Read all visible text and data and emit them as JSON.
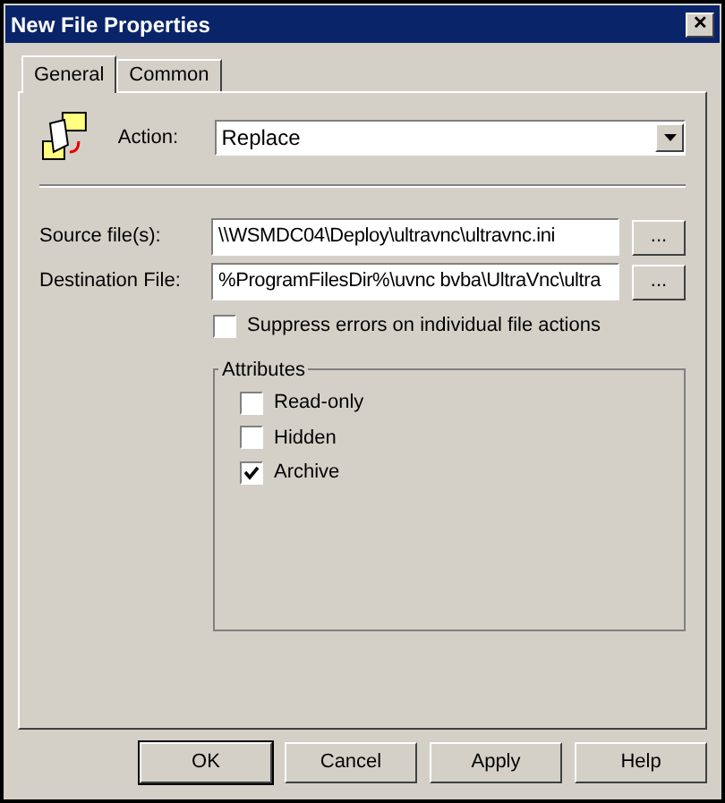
{
  "window": {
    "title": "New File Properties",
    "close": "✕"
  },
  "tabs": [
    {
      "label": "General",
      "selected": true
    },
    {
      "label": "Common",
      "selected": false
    }
  ],
  "action": {
    "label": "Action:",
    "value": "Replace"
  },
  "fields": [
    {
      "label": "Source file(s):",
      "value": "\\\\WSMDC04\\Deploy\\ultravnc\\ultravnc.ini",
      "browse": "..."
    },
    {
      "label": "Destination File:",
      "value": "%ProgramFilesDir%\\uvnc bvba\\UltraVnc\\ultra",
      "browse": "..."
    }
  ],
  "suppress": {
    "label": "Suppress errors on individual file actions",
    "checked": false
  },
  "attributes": {
    "title": "Attributes",
    "items": [
      {
        "label": "Read-only",
        "checked": false
      },
      {
        "label": "Hidden",
        "checked": false
      },
      {
        "label": "Archive",
        "checked": true
      }
    ]
  },
  "buttons": [
    {
      "label": "OK",
      "default": true
    },
    {
      "label": "Cancel",
      "default": false
    },
    {
      "label": "Apply",
      "default": false
    },
    {
      "label": "Help",
      "default": false
    }
  ]
}
